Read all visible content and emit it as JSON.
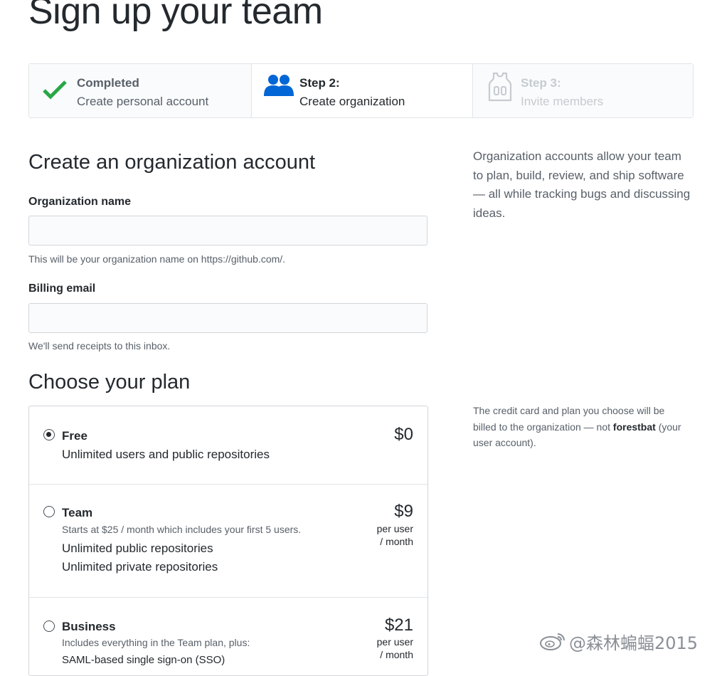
{
  "page": {
    "title": "Sign up your team"
  },
  "steps": [
    {
      "label": "Completed",
      "desc": "Create personal account",
      "icon": "checkmark-icon",
      "state": "completed",
      "color": "#28a745"
    },
    {
      "label": "Step 2:",
      "desc": "Create organization",
      "icon": "people-icon",
      "state": "current",
      "color": "#0366d6"
    },
    {
      "label": "Step 3:",
      "desc": "Invite members",
      "icon": "jersey-icon",
      "state": "upcoming",
      "color": "#c6cbd1"
    }
  ],
  "form": {
    "heading": "Create an organization account",
    "org_name": {
      "label": "Organization name",
      "value": "",
      "placeholder": "",
      "note": "This will be your organization name on https://github.com/."
    },
    "billing_email": {
      "label": "Billing email",
      "value": "",
      "placeholder": "",
      "note": "We'll send receipts to this inbox."
    }
  },
  "sidebar": {
    "org_info": "Organization accounts allow your team to plan, build, review, and ship software — all while tracking bugs and discussing ideas.",
    "billing_info_prefix": "The credit card and plan you choose will be billed to the organization — not ",
    "billing_info_user": "forestbat",
    "billing_info_suffix": " (your user account)."
  },
  "plans": {
    "heading": "Choose your plan",
    "items": [
      {
        "name": "Free",
        "price": "$0",
        "price_unit_1": "",
        "price_unit_2": "",
        "description": "",
        "features": [
          "Unlimited users and public repositories"
        ],
        "selected": true
      },
      {
        "name": "Team",
        "price": "$9",
        "price_unit_1": "per user",
        "price_unit_2": "/ month",
        "description": "Starts at $25 / month which includes your first 5 users.",
        "features": [
          "Unlimited public repositories",
          "Unlimited private repositories"
        ],
        "selected": false
      },
      {
        "name": "Business",
        "price": "$21",
        "price_unit_1": "per user",
        "price_unit_2": "/ month",
        "description": "Includes everything in the Team plan, plus:",
        "features": [
          "SAML-based single sign-on (SSO)"
        ],
        "selected": false
      }
    ]
  },
  "watermark": {
    "text": "@森林蝙蝠2015",
    "icon": "weibo-logo-icon"
  },
  "colors": {
    "text": "#24292e",
    "muted": "#586069",
    "border": "#e1e4e8",
    "success": "#28a745",
    "accent": "#0366d6"
  }
}
